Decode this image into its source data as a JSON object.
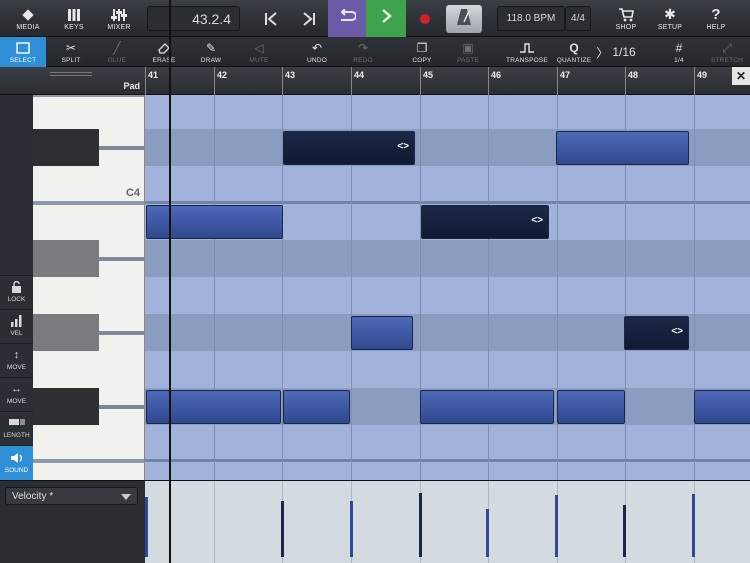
{
  "topbar": {
    "media": "MEDIA",
    "keys": "KEYS",
    "mixer": "MIXER",
    "position": "43.2.4",
    "tempo": "118.0 BPM",
    "signature": "4/4",
    "shop": "SHOP",
    "setup": "SETUP",
    "help": "HELP"
  },
  "toolbar": {
    "select": "SELECT",
    "split": "SPLIT",
    "glue": "GLUE",
    "erase": "ERASE",
    "draw": "DRAW",
    "mute": "MUTE",
    "undo": "UNDO",
    "redo": "REDO",
    "copy": "COPY",
    "paste": "PASTE",
    "transpose": "TRANSPOSE",
    "quantize": "QUANTIZE",
    "quantize_value": "1/16",
    "grid_value": "1/4",
    "stretch": "STRETCH"
  },
  "ruler": {
    "track_name": "Pad",
    "bars": [
      "41",
      "42",
      "43",
      "44",
      "45",
      "46",
      "47",
      "48",
      "49"
    ]
  },
  "piano": {
    "c_label": "C4"
  },
  "side": {
    "lock": "LOCK",
    "vel": "VEL",
    "move_v": "MOVE",
    "move_h": "MOVE",
    "length": "LENGTH",
    "sound": "SOUND"
  },
  "velocity": {
    "parameter": "Velocity *"
  },
  "colors": {
    "accent": "#2e8fd6",
    "loop": "#6c5aa8",
    "play": "#3fa34d",
    "record": "#d6202a"
  }
}
